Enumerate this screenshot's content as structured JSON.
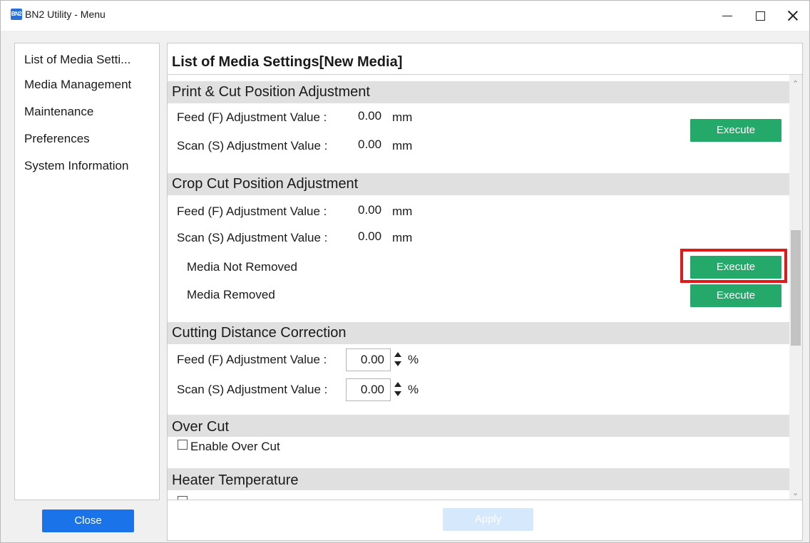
{
  "window": {
    "title": "BN2 Utility - Menu",
    "app_icon_text": "BN2",
    "icons": [
      "minimize-icon",
      "maximize-icon",
      "close-icon"
    ]
  },
  "sidebar": {
    "items": [
      {
        "label": "List of Media Setti..."
      },
      {
        "label": "Media Management"
      },
      {
        "label": "Maintenance"
      },
      {
        "label": "Preferences"
      },
      {
        "label": "System Information"
      }
    ],
    "close_label": "Close"
  },
  "main": {
    "title": "List of Media Settings[New Media]",
    "sections": {
      "print_cut": {
        "title": "Print & Cut Position Adjustment",
        "feed_label": "Feed (F) Adjustment Value :",
        "feed_value": "0.00",
        "scan_label": "Scan (S) Adjustment Value :",
        "scan_value": "0.00",
        "unit": "mm",
        "execute_label": "Execute"
      },
      "crop_cut": {
        "title": "Crop Cut Position Adjustment",
        "feed_label": "Feed (F) Adjustment Value :",
        "feed_value": "0.00",
        "scan_label": "Scan (S) Adjustment Value :",
        "scan_value": "0.00",
        "unit": "mm",
        "not_removed_label": "Media Not Removed",
        "removed_label": "Media Removed",
        "execute_label": "Execute"
      },
      "cutting_distance": {
        "title": "Cutting Distance Correction",
        "feed_label": "Feed (F) Adjustment Value :",
        "feed_value": "0.00",
        "scan_label": "Scan (S) Adjustment Value :",
        "scan_value": "0.00",
        "unit": "%"
      },
      "over_cut": {
        "title": "Over Cut",
        "enable_label": "Enable Over Cut",
        "enabled": false
      },
      "heater": {
        "title": "Heater Temperature"
      }
    },
    "apply_label": "Apply"
  },
  "colors": {
    "execute": "#25a96a",
    "close_button": "#1a73e8",
    "apply_disabled": "#d6e8fb",
    "highlight": "#e01919",
    "section_bar": "#e0e0e0"
  }
}
